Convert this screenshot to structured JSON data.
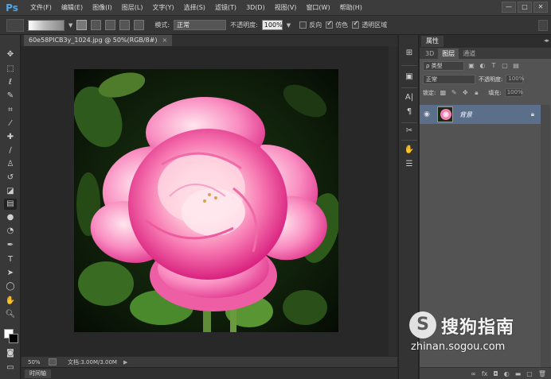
{
  "app": {
    "logo": "Ps"
  },
  "menu": [
    "文件(F)",
    "编辑(E)",
    "图像(I)",
    "图层(L)",
    "文字(Y)",
    "选择(S)",
    "滤镜(T)",
    "3D(D)",
    "视图(V)",
    "窗口(W)",
    "帮助(H)"
  ],
  "window_controls": {
    "minimize": "—",
    "restore": "□",
    "close": "✕"
  },
  "options": {
    "mode_label": "模式:",
    "mode_value": "正常",
    "opacity_label": "不透明度:",
    "opacity_value": "100%",
    "reverse_label": "反向",
    "reverse_checked": false,
    "dither_label": "仿色",
    "dither_checked": true,
    "transparency_label": "透明区域",
    "transparency_checked": true
  },
  "document": {
    "tab_title": "60e58PICB3y_1024.jpg @ 50%(RGB/8#)",
    "close": "×",
    "zoom": "50%",
    "doc_size": "文档:3.00M/3.00M",
    "status_arrow": "▶"
  },
  "timeline": {
    "label": "时间轴"
  },
  "panels": {
    "title": "属性",
    "tabs": [
      "3D",
      "图层",
      "通道"
    ],
    "active_tab": 1,
    "filter_kind": "ρ 类型",
    "blend_mode": "正常",
    "opacity_label": "不透明度:",
    "opacity_value": "100%",
    "lock_label": "锁定:",
    "fill_label": "填充:",
    "fill_value": "100%",
    "layer_name": "背景",
    "collapse": "◂▸"
  },
  "colors": {
    "foreground": "#ffffff",
    "background": "#000000",
    "accent": "#4fa7e8",
    "layer_selected": "#5b6f8a"
  },
  "watermark": {
    "logo": "S",
    "brand": "搜狗指南",
    "url": "zhinan.sogou.com"
  }
}
